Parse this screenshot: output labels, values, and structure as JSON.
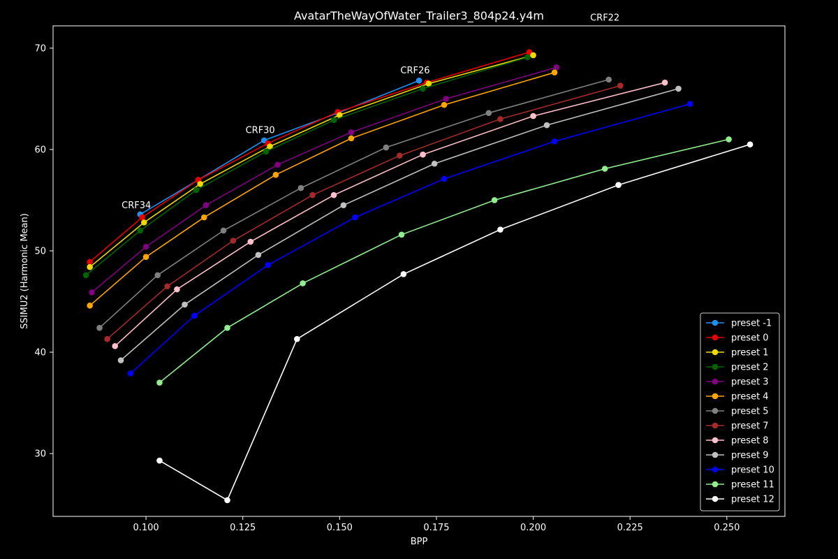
{
  "chart_data": {
    "type": "line",
    "title": "AvatarTheWayOfWater_Trailer3_804p24.y4m",
    "xlabel": "BPP",
    "ylabel": "SSIMU2 (Harmonic Mean)",
    "xlim": [
      0.076,
      0.265
    ],
    "ylim": [
      23.8,
      72.2
    ],
    "xticks": [
      0.1,
      0.125,
      0.15,
      0.175,
      0.2,
      0.225,
      0.25
    ],
    "xtick_labels": [
      "0.100",
      "0.125",
      "0.150",
      "0.175",
      "0.200",
      "0.225",
      "0.250"
    ],
    "yticks": [
      30,
      40,
      50,
      60,
      70
    ],
    "ytick_labels": [
      "30",
      "40",
      "50",
      "60",
      "70"
    ],
    "grid": false,
    "legend_position": "bottom-right",
    "annotations": [
      {
        "text": "CRF34",
        "x": 0.0975,
        "y": 54.2
      },
      {
        "text": "CRF30",
        "x": 0.1295,
        "y": 61.6
      },
      {
        "text": "CRF26",
        "x": 0.1695,
        "y": 67.5
      },
      {
        "text": "CRF22",
        "x": 0.2185,
        "y": 72.7
      }
    ],
    "series": [
      {
        "name": "preset -1",
        "color": "#1f8ff0",
        "x": [
          0.0985,
          0.1135,
          0.1305,
          0.1495,
          0.1705
        ],
        "y": [
          53.6,
          57.0,
          60.9,
          63.6,
          66.8
        ]
      },
      {
        "name": "preset 0",
        "color": "#e80000",
        "x": [
          0.0855,
          0.099,
          0.1135,
          0.1315,
          0.1495,
          0.1725,
          0.199
        ],
        "y": [
          48.9,
          53.3,
          57.0,
          60.6,
          63.7,
          66.6,
          69.6
        ]
      },
      {
        "name": "preset 1",
        "color": "#f0d800",
        "x": [
          0.0855,
          0.0995,
          0.114,
          0.132,
          0.15,
          0.173,
          0.2
        ],
        "y": [
          48.4,
          52.8,
          56.6,
          60.3,
          63.4,
          66.5,
          69.3
        ]
      },
      {
        "name": "preset 2",
        "color": "#006400",
        "x": [
          0.0845,
          0.0985,
          0.113,
          0.131,
          0.1485,
          0.1715,
          0.1985
        ],
        "y": [
          47.6,
          52.0,
          56.0,
          59.8,
          62.9,
          66.0,
          69.1
        ]
      },
      {
        "name": "preset 3",
        "color": "#800080",
        "x": [
          0.086,
          0.1,
          0.1155,
          0.134,
          0.153,
          0.1775,
          0.206
        ],
        "y": [
          45.9,
          50.4,
          54.5,
          58.5,
          61.7,
          65.0,
          68.1
        ]
      },
      {
        "name": "preset 4",
        "color": "#ffa500",
        "x": [
          0.0855,
          0.1,
          0.115,
          0.1335,
          0.153,
          0.177,
          0.2055
        ],
        "y": [
          44.6,
          49.4,
          53.3,
          57.5,
          61.1,
          64.4,
          67.6
        ]
      },
      {
        "name": "preset 5",
        "color": "#808080",
        "x": [
          0.088,
          0.103,
          0.12,
          0.14,
          0.162,
          0.1885,
          0.2195
        ],
        "y": [
          42.4,
          47.6,
          52.0,
          56.2,
          60.2,
          63.6,
          66.9
        ]
      },
      {
        "name": "preset 7",
        "color": "#a52a2a",
        "x": [
          0.09,
          0.1055,
          0.1225,
          0.143,
          0.1655,
          0.1915,
          0.2225
        ],
        "y": [
          41.3,
          46.5,
          51.0,
          55.5,
          59.4,
          63.0,
          66.3
        ]
      },
      {
        "name": "preset 8",
        "color": "#ffc0cb",
        "x": [
          0.092,
          0.108,
          0.127,
          0.1485,
          0.1715,
          0.2,
          0.234
        ],
        "y": [
          40.6,
          46.2,
          50.9,
          55.5,
          59.5,
          63.3,
          66.6
        ]
      },
      {
        "name": "preset 9",
        "color": "#c0c0c0",
        "x": [
          0.0935,
          0.11,
          0.129,
          0.151,
          0.1745,
          0.2035,
          0.2375
        ],
        "y": [
          39.2,
          44.7,
          49.6,
          54.5,
          58.6,
          62.4,
          66.0
        ]
      },
      {
        "name": "preset 10",
        "color": "#0000ff",
        "x": [
          0.096,
          0.1125,
          0.1315,
          0.154,
          0.177,
          0.2055,
          0.2405
        ],
        "y": [
          37.9,
          43.6,
          48.6,
          53.3,
          57.1,
          60.8,
          64.5
        ]
      },
      {
        "name": "preset 11",
        "color": "#90ee90",
        "x": [
          0.1035,
          0.121,
          0.1405,
          0.166,
          0.19,
          0.2185,
          0.2505
        ],
        "y": [
          37.0,
          42.4,
          46.8,
          51.6,
          55.0,
          58.1,
          61.0
        ]
      },
      {
        "name": "preset 12",
        "color": "#ffffff",
        "x": [
          0.1035,
          0.121,
          0.139,
          0.1665,
          0.1915,
          0.222,
          0.256
        ],
        "y": [
          29.3,
          25.4,
          41.3,
          47.7,
          52.1,
          56.5,
          60.5
        ]
      }
    ]
  }
}
